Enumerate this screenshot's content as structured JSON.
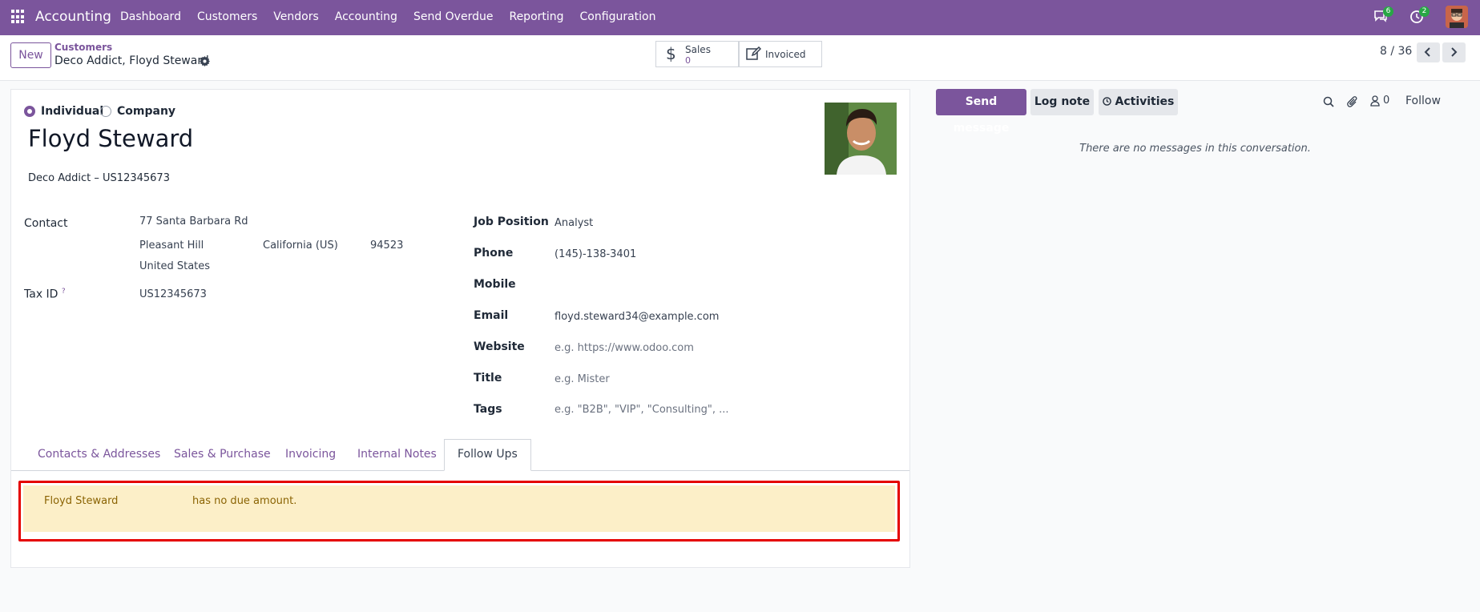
{
  "topbar": {
    "app_name": "Accounting",
    "menu": [
      "Dashboard",
      "Customers",
      "Vendors",
      "Accounting",
      "Send Overdue",
      "Reporting",
      "Configuration"
    ],
    "messages_count": "6",
    "activities_count": "2",
    "bar_color": "#7b559c"
  },
  "controlbar": {
    "new_label": "New",
    "breadcrumb_parent": "Customers",
    "breadcrumb_current": "Deco Addict, Floyd Steward",
    "stat_sales_label": "Sales",
    "stat_sales_value": "0",
    "stat_invoiced_label": "Invoiced",
    "pager": "8 / 36"
  },
  "form": {
    "type_individual": "Individual",
    "type_company": "Company",
    "selected_type": "Individual",
    "name": "Floyd Steward",
    "company_line": "Deco Addict – US12345673",
    "contact_label": "Contact",
    "street": "77 Santa Barbara Rd",
    "city": "Pleasant Hill",
    "state": "California (US)",
    "zip": "94523",
    "country": "United States",
    "tax_id_label": "Tax ID",
    "tax_id_help": "?",
    "tax_id": "US12345673",
    "job_position_label": "Job Position",
    "job_position": "Analyst",
    "phone_label": "Phone",
    "phone": "(145)-138-3401",
    "mobile_label": "Mobile",
    "email_label": "Email",
    "email": "floyd.steward34@example.com",
    "website_label": "Website",
    "website_placeholder": "e.g. https://www.odoo.com",
    "title_label": "Title",
    "title_placeholder": "e.g. Mister",
    "tags_label": "Tags",
    "tags_placeholder": "e.g. \"B2B\", \"VIP\", \"Consulting\", ..."
  },
  "tabs": [
    "Contacts & Addresses",
    "Sales & Purchase",
    "Invoicing",
    "Internal Notes",
    "Follow Ups"
  ],
  "active_tab": "Follow Ups",
  "followup": {
    "partner": "Floyd Steward",
    "message": "has no due amount."
  },
  "chatter": {
    "send_message": "Send message",
    "log_note": "Log note",
    "activities": "Activities",
    "followers_count": "0",
    "follow": "Follow",
    "empty": "There are no messages in this conversation."
  }
}
